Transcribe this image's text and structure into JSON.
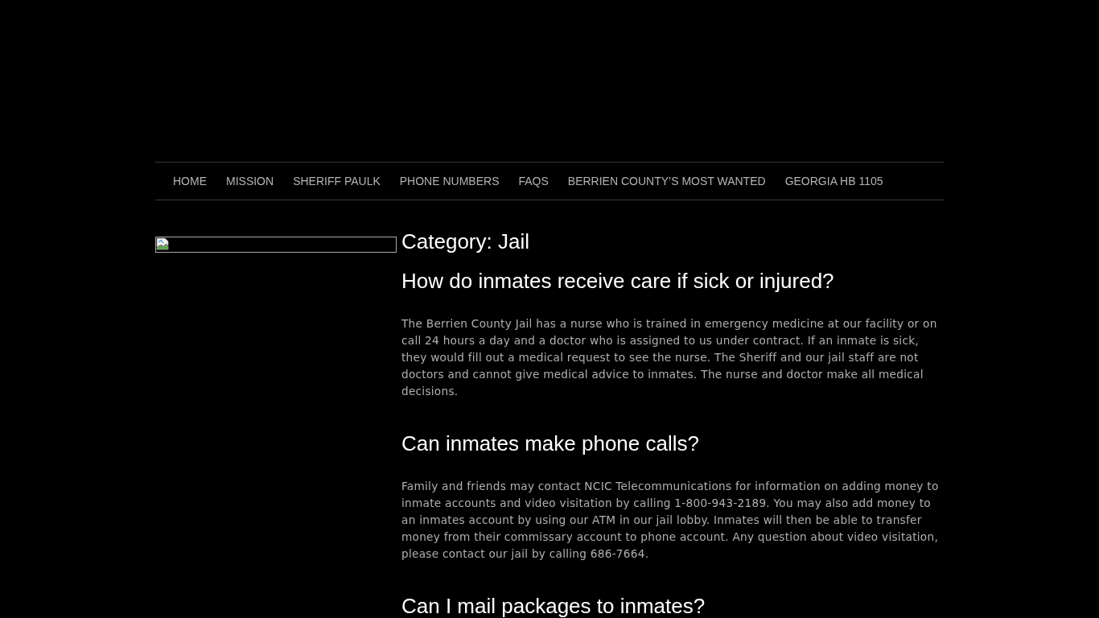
{
  "nav": {
    "items": [
      {
        "label": "HOME"
      },
      {
        "label": "MISSION"
      },
      {
        "label": "SHERIFF PAULK"
      },
      {
        "label": "PHONE NUMBERS"
      },
      {
        "label": "FAQS"
      },
      {
        "label": "BERRIEN COUNTY’S MOST WANTED"
      },
      {
        "label": "GEORGIA HB 1105"
      }
    ]
  },
  "main": {
    "page_title": "Category: Jail",
    "posts": [
      {
        "title": "How do inmates receive care if sick or injured?",
        "body": "The Berrien County Jail has a nurse who is trained in emergency medicine at our facility or on call 24 hours a day and a doctor who is assigned to us under contract. If an inmate is sick, they would fill out a medical request to see the nurse. The Sheriff and our jail staff are not doctors and cannot give medical advice to inmates. The nurse and doctor make all medical decisions."
      },
      {
        "title": "Can inmates make phone calls?",
        "body": "Family and friends may contact NCIC Telecommunications for information on adding money to inmate accounts and video visitation by calling 1-800-943-2189. You may also add money to an inmates account by using our ATM in our jail lobby. Inmates will then be able to transfer money from their commissary account to phone account. Any question about video visitation, please contact our jail by calling 686-7664."
      },
      {
        "title": "Can I mail packages to inmates?"
      }
    ]
  }
}
